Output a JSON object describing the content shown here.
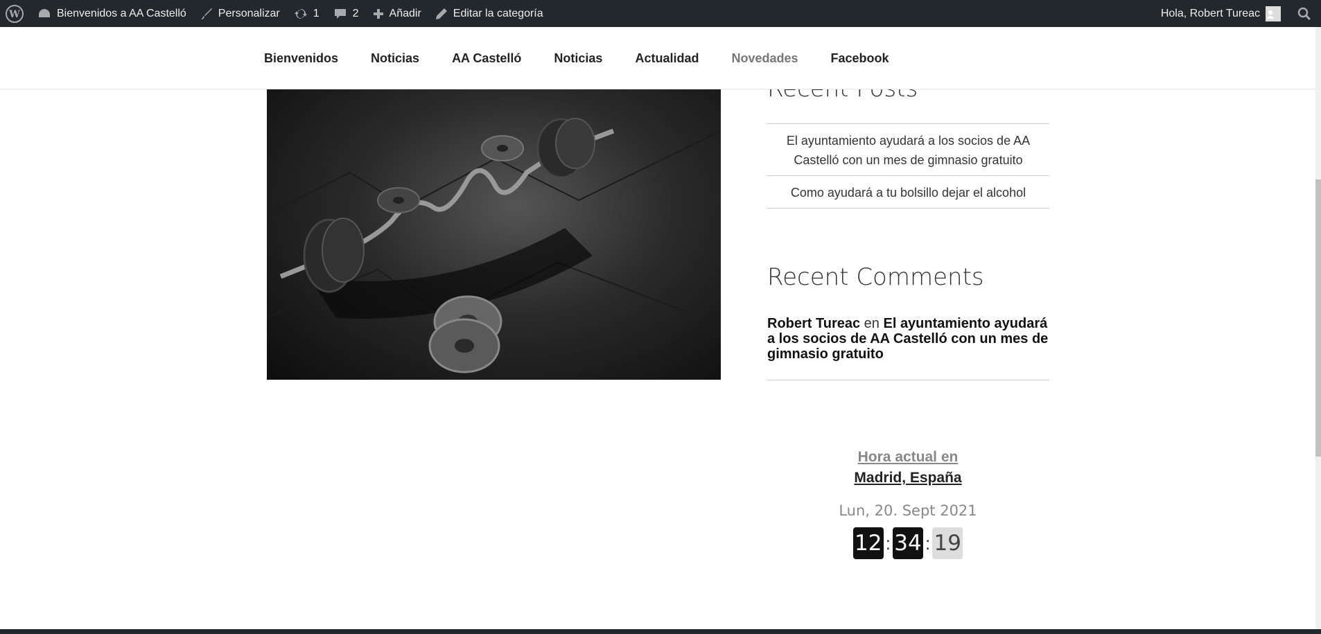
{
  "adminbar": {
    "site_name": "Bienvenidos a AA Castelló",
    "customize": "Personalizar",
    "updates_count": "1",
    "comments_count": "2",
    "add_new": "Añadir",
    "edit_category": "Editar la categoría",
    "greeting": "Hola, Robert Tureac"
  },
  "nav": {
    "items": [
      "Bienvenidos",
      "Noticias",
      "AA Castelló",
      "Noticias",
      "Actualidad",
      "Novedades",
      "Facebook"
    ]
  },
  "recent_posts": {
    "heading": "Recent Posts",
    "items": [
      "El ayuntamiento ayudará a los socios de AA Castelló con un mes de gimnasio gratuito",
      "Como ayudará a tu bolsillo dejar el alcohol"
    ]
  },
  "recent_comments": {
    "heading": "Recent Comments",
    "author": "Robert Tureac",
    "connector": "en",
    "post_title": "El ayuntamiento ayudará a los socios de AA Castelló con un mes de gimnasio gratuito"
  },
  "clock": {
    "title_line1": "Hora actual en",
    "title_line2": "Madrid, España",
    "date": "Lun, 20. Sept 2021",
    "hours": "12",
    "minutes": "34",
    "seconds": "19"
  }
}
